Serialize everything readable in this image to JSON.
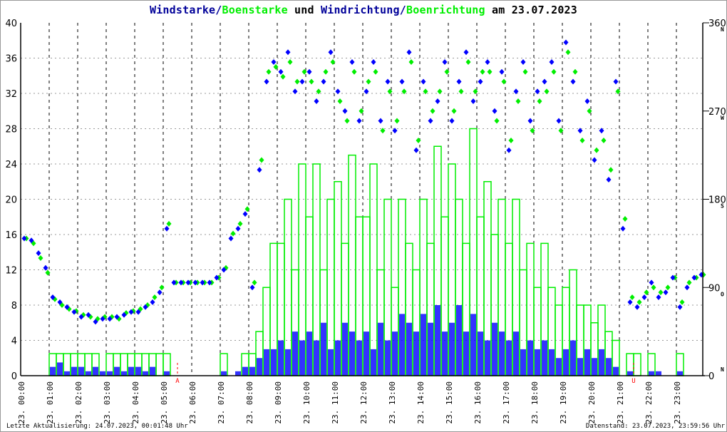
{
  "title": {
    "part1": "Windstarke",
    "sep1": "/",
    "part2": "Boenstarke",
    "mid": " und ",
    "part3": "Windrichtung",
    "sep2": "/",
    "part4": "Boenrichtung",
    "date": " am 23.07.2023"
  },
  "footer": {
    "left": "Letzte Aktualisierung: 24.07.2023, 00:01:48 Uhr",
    "right": "Datenstand: 23.07.2023, 23:59:56 Uhr"
  },
  "colors": {
    "speed": "#0000ff",
    "gust": "#00ee00",
    "title_blue": "#000099",
    "marker": "#ff0000"
  },
  "chart_data": {
    "type": "bar",
    "title": "Windstarke/Boenstarke und Windrichtung/Boenrichtung am 23.07.2023",
    "x_interval_minutes": 15,
    "x_ticks": [
      "23. 00:00",
      "23. 01:00",
      "23. 02:00",
      "23. 03:00",
      "23. 04:00",
      "23. 05:00",
      "23. 06:00",
      "23. 07:00",
      "23. 08:00",
      "23. 09:00",
      "23. 10:00",
      "23. 11:00",
      "23. 12:00",
      "23. 13:00",
      "23. 14:00",
      "23. 15:00",
      "23. 16:00",
      "23. 17:00",
      "23. 18:00",
      "23. 19:00",
      "23. 20:00",
      "23. 21:00",
      "23. 22:00",
      "23. 23:00"
    ],
    "ylim": [
      0,
      40
    ],
    "y_ticks": [
      0,
      4,
      8,
      12,
      16,
      20,
      24,
      28,
      32,
      36,
      40
    ],
    "y2lim": [
      0,
      360
    ],
    "y2_ticks": [
      {
        "v": 0,
        "l": "0",
        "d": "N"
      },
      {
        "v": 90,
        "l": "90",
        "d": "O"
      },
      {
        "v": 180,
        "l": "180",
        "d": "S"
      },
      {
        "v": 270,
        "l": "270",
        "d": "W"
      },
      {
        "v": 360,
        "l": "360",
        "d": "N"
      }
    ],
    "grid": true,
    "markers": [
      {
        "label": "A",
        "hour": 5.5
      },
      {
        "label": "U",
        "hour": 21.5
      }
    ],
    "series": [
      {
        "name": "Windstarke",
        "values": [
          0,
          0,
          0,
          0,
          1,
          1.5,
          0.5,
          1,
          1,
          0.5,
          1,
          0.5,
          0.5,
          1,
          0.5,
          1,
          1,
          0.5,
          1,
          0,
          0.5,
          0,
          0,
          0,
          0,
          0,
          0,
          0,
          0.5,
          0,
          0.5,
          1,
          1,
          2,
          3,
          3,
          4,
          3,
          5,
          4,
          5,
          4,
          6,
          3,
          4,
          6,
          5,
          4,
          5,
          3,
          6,
          4,
          5,
          7,
          6,
          5,
          7,
          6,
          8,
          5,
          6,
          8,
          5,
          7,
          5,
          4,
          6,
          5,
          4,
          5,
          3,
          4,
          3,
          4,
          3,
          2,
          3,
          4,
          2,
          3,
          2,
          3,
          2,
          1,
          0,
          0.5,
          0,
          0,
          0.5,
          0.5,
          0,
          0,
          0.5,
          0,
          0,
          0
        ]
      },
      {
        "name": "Boenstarke",
        "values": [
          0,
          0,
          0,
          0,
          2.5,
          2.5,
          2.5,
          2.5,
          2.5,
          2.5,
          2.5,
          0,
          2.5,
          2.5,
          2.5,
          2.5,
          2.5,
          2.5,
          2.5,
          2.5,
          2.5,
          0,
          0,
          0,
          0,
          0,
          0,
          0,
          2.5,
          0,
          0,
          2.5,
          2.5,
          5,
          10,
          15,
          15,
          20,
          12,
          24,
          18,
          24,
          12,
          20,
          22,
          15,
          25,
          18,
          18,
          24,
          12,
          20,
          10,
          20,
          15,
          12,
          20,
          15,
          26,
          18,
          24,
          20,
          15,
          28,
          18,
          22,
          16,
          20,
          15,
          20,
          12,
          15,
          10,
          15,
          10,
          8,
          10,
          12,
          8,
          8,
          6,
          8,
          5,
          4,
          0,
          2.5,
          2.5,
          0,
          2.5,
          0,
          0,
          0,
          2.5,
          0,
          0,
          0
        ]
      },
      {
        "name": "Windrichtung",
        "values": [
          140,
          138,
          125,
          110,
          80,
          75,
          70,
          65,
          60,
          62,
          55,
          58,
          58,
          60,
          62,
          65,
          65,
          70,
          75,
          85,
          150,
          95,
          95,
          95,
          95,
          95,
          95,
          100,
          108,
          140,
          150,
          165,
          90,
          210,
          300,
          320,
          310,
          330,
          290,
          300,
          310,
          280,
          300,
          330,
          290,
          270,
          320,
          260,
          290,
          320,
          260,
          300,
          250,
          300,
          330,
          230,
          300,
          260,
          280,
          320,
          260,
          300,
          330,
          280,
          300,
          320,
          270,
          310,
          230,
          290,
          320,
          260,
          290,
          300,
          320,
          260,
          340,
          300,
          250,
          280,
          220,
          250,
          200,
          300,
          150,
          75,
          70,
          80,
          95,
          80,
          85,
          100,
          70,
          90,
          100,
          103
        ]
      },
      {
        "name": "Boenrichtung",
        "values": [
          140,
          135,
          120,
          105,
          78,
          72,
          68,
          66,
          62,
          60,
          58,
          60,
          60,
          58,
          64,
          66,
          68,
          72,
          80,
          90,
          155,
          95,
          95,
          95,
          95,
          95,
          95,
          100,
          110,
          145,
          155,
          170,
          95,
          220,
          310,
          315,
          305,
          320,
          300,
          310,
          300,
          290,
          310,
          320,
          280,
          260,
          310,
          270,
          300,
          310,
          250,
          290,
          260,
          290,
          320,
          240,
          290,
          270,
          290,
          310,
          270,
          290,
          320,
          290,
          310,
          310,
          260,
          300,
          240,
          280,
          310,
          250,
          280,
          290,
          310,
          250,
          330,
          310,
          240,
          270,
          230,
          240,
          210,
          290,
          160,
          80,
          75,
          85,
          90,
          85,
          90,
          100,
          75,
          95,
          100,
          103
        ]
      }
    ]
  }
}
